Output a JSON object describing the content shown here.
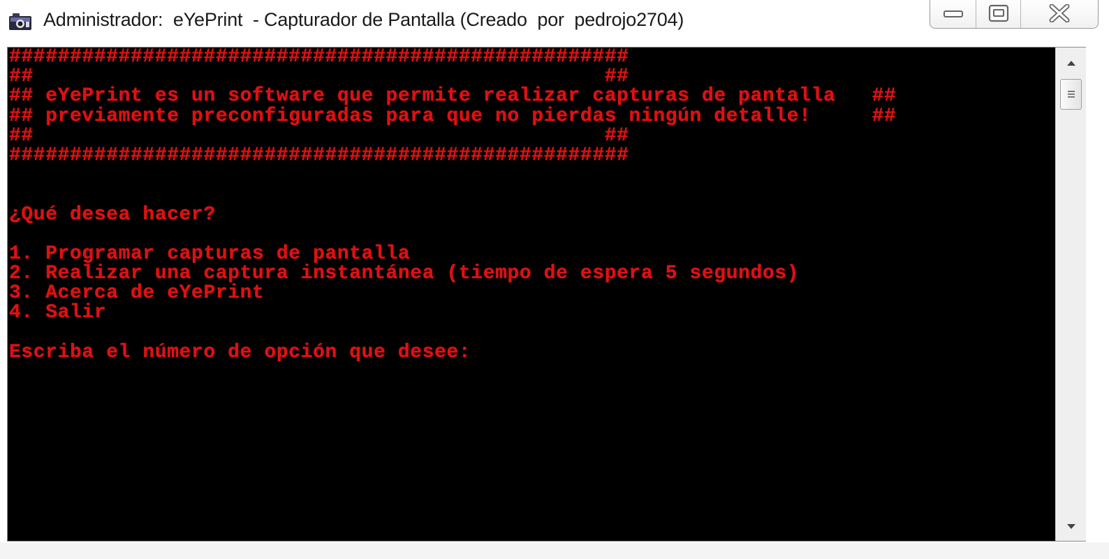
{
  "window": {
    "title": "Administrador:  eYePrint  - Capturador de Pantalla (Creado  por  pedrojo2704)",
    "icon": "camera-icon",
    "controls": {
      "minimize": "minimize-icon",
      "maximize": "maximize-icon",
      "close": "close-icon"
    }
  },
  "console": {
    "text_color": "#e01010",
    "background": "#000000",
    "banner": {
      "border_line": "###################################################",
      "empty_line": "##                                               ##",
      "line1": "## eYePrint es un software que permite realizar capturas de pantalla   ##",
      "line2": "## previamente preconfiguradas para que no pierdas ningún detalle!     ##"
    },
    "question": "¿Qué desea hacer?",
    "options": [
      "1. Programar capturas de pantalla",
      "2. Realizar una captura instantánea (tiempo de espera 5 segundos)",
      "3. Acerca de eYePrint",
      "4. Salir"
    ],
    "prompt": "Escriba el número de opción que desee:",
    "input_value": ""
  },
  "scrollbar": {
    "up": "scroll-up-arrow-icon",
    "down": "scroll-down-arrow-icon",
    "thumb": "scroll-thumb-grip-icon"
  }
}
